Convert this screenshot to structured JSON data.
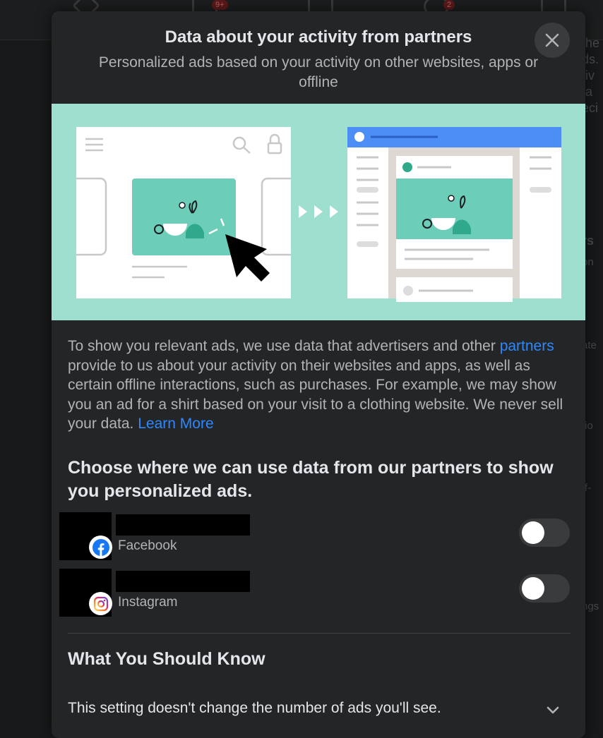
{
  "background": {
    "badges": [
      "9+",
      "2"
    ],
    "side_text": [
      "the",
      "ds.",
      "tiv",
      "ta",
      "eci",
      "rs",
      "on",
      "ate",
      "tio",
      "ff-",
      "ngs"
    ]
  },
  "modal": {
    "title": "Data about your activity from partners",
    "subtitle": "Personalized ads based on your activity on other websites, apps or offline",
    "close_icon": "close-icon",
    "illustration": "ad-personalization-illustration"
  },
  "description": {
    "intro": "To show you relevant ads, we use data that advertisers and other ",
    "partners_link": "partners",
    "rest": " provide to us about your activity on their websites and apps, as well as certain offline interactions, such as purchases. For example, we may show you an ad for a shirt based on your visit to a clothing website. We never sell your data. ",
    "learn_more": "Learn More"
  },
  "choose_heading": "Choose where we can use data from our partners to show you personalized ads.",
  "accounts": [
    {
      "platform": "Facebook",
      "icon": "facebook-icon",
      "enabled": false
    },
    {
      "platform": "Instagram",
      "icon": "instagram-icon",
      "enabled": false
    }
  ],
  "know": {
    "heading": "What You Should Know",
    "items": [
      {
        "text": "This setting doesn't change the number of ads you'll see.",
        "icon": "chevron-down-icon"
      }
    ]
  },
  "colors": {
    "modal_bg": "#242526",
    "illustration_bg": "#9fdfcf",
    "link": "#2d88ff",
    "toggle_off": "#3a3b3c",
    "facebook_blue": "#1877f2"
  }
}
